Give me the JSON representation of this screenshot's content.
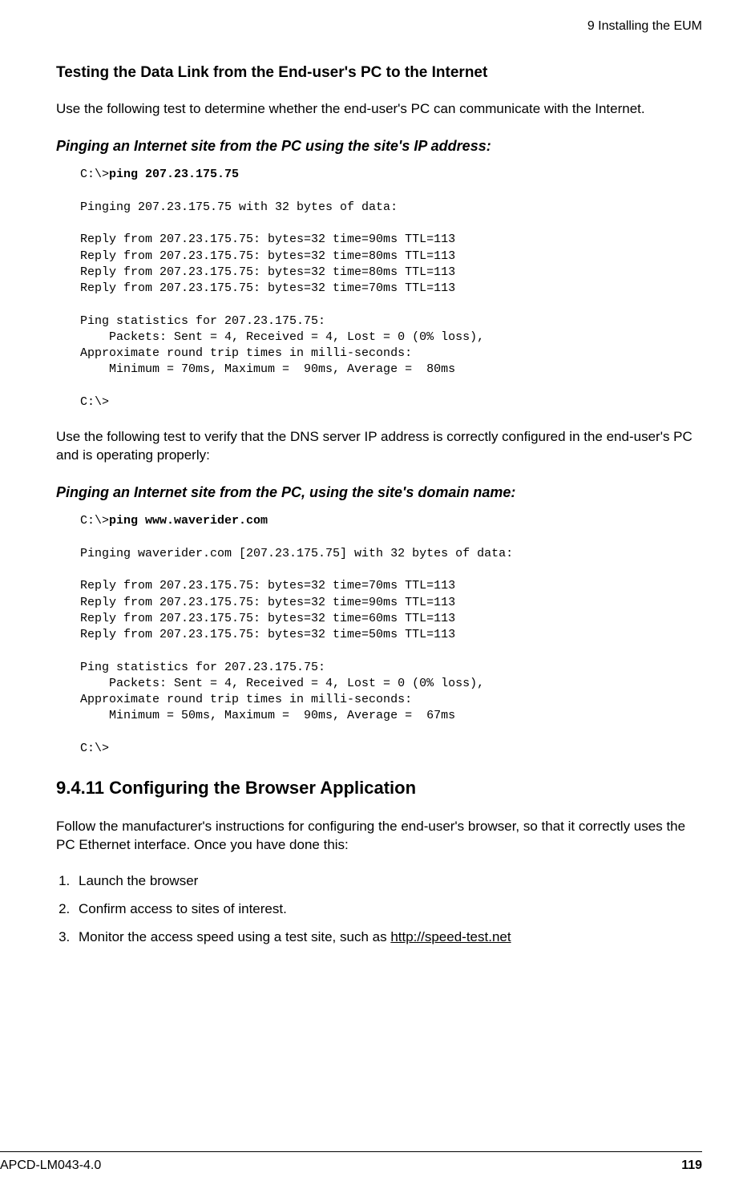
{
  "header": {
    "running": "9  Installing the EUM"
  },
  "section1": {
    "title": "Testing the Data Link from the End-user's PC to the Internet",
    "intro": "Use the following test to determine whether the end-user's PC can communicate with the Internet.",
    "sub1": "Pinging an Internet site from the PC using the site's IP address:",
    "code1_prompt": "C:\\>",
    "code1_cmd": "ping 207.23.175.75",
    "code1_body": "\n\nPinging 207.23.175.75 with 32 bytes of data:\n\nReply from 207.23.175.75: bytes=32 time=90ms TTL=113\nReply from 207.23.175.75: bytes=32 time=80ms TTL=113\nReply from 207.23.175.75: bytes=32 time=80ms TTL=113\nReply from 207.23.175.75: bytes=32 time=70ms TTL=113\n\nPing statistics for 207.23.175.75:\n    Packets: Sent = 4, Received = 4, Lost = 0 (0% loss),\nApproximate round trip times in milli-seconds:\n    Minimum = 70ms, Maximum =  90ms, Average =  80ms\n\nC:\\>",
    "mid": "Use the following test to verify that the DNS server IP address is correctly configured in the end-user's PC and is operating properly:",
    "sub2": "Pinging an Internet site from the PC, using the site's domain name:",
    "code2_prompt": "C:\\>",
    "code2_cmd": "ping www.waverider.com",
    "code2_body": "\n\nPinging waverider.com [207.23.175.75] with 32 bytes of data:\n\nReply from 207.23.175.75: bytes=32 time=70ms TTL=113\nReply from 207.23.175.75: bytes=32 time=90ms TTL=113\nReply from 207.23.175.75: bytes=32 time=60ms TTL=113\nReply from 207.23.175.75: bytes=32 time=50ms TTL=113\n\nPing statistics for 207.23.175.75:\n    Packets: Sent = 4, Received = 4, Lost = 0 (0% loss),\nApproximate round trip times in milli-seconds:\n    Minimum = 50ms, Maximum =  90ms, Average =  67ms\n\nC:\\>"
  },
  "section2": {
    "heading": "9.4.11 Configuring the Browser Application",
    "intro": "Follow the manufacturer's instructions for configuring the end-user's browser, so that it correctly uses the PC Ethernet interface. Once you have done this:",
    "steps": {
      "s1": "Launch the browser",
      "s2": "Confirm access to sites of interest.",
      "s3_pre": "Monitor the access speed using a test site, such as ",
      "s3_link": "http://speed-test.net"
    }
  },
  "footer": {
    "doc": "APCD-LM043-4.0",
    "page": "119"
  }
}
